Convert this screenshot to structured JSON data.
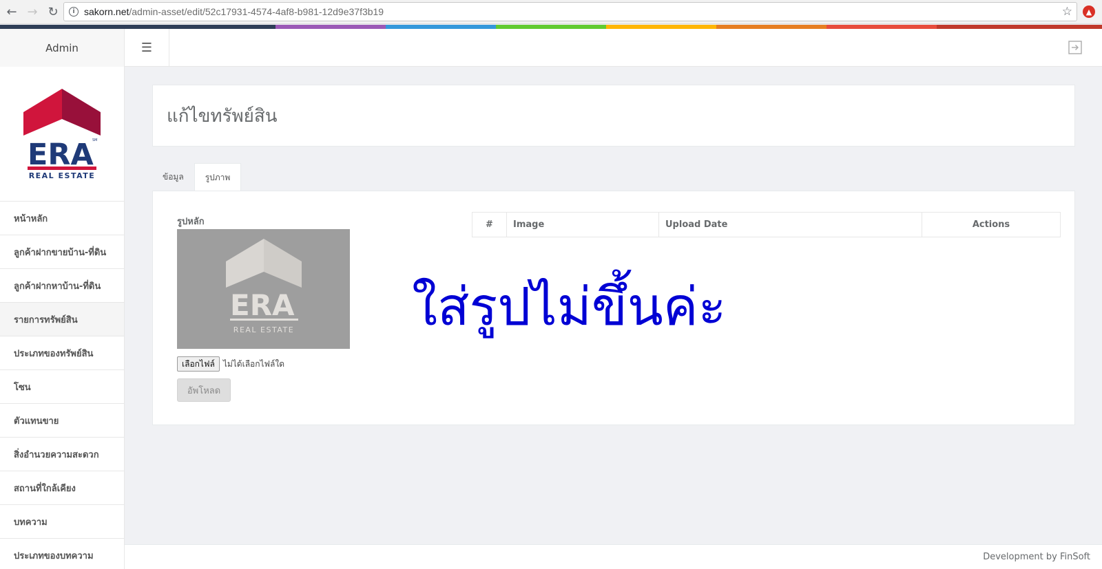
{
  "browser": {
    "url_host": "sakorn.net",
    "url_path": "/admin-asset/edit/52c17931-4574-4af8-b981-12d9e37f3b19"
  },
  "header": {
    "brand": "Admin",
    "menu_icon": "hamburger-icon",
    "logout_icon": "sign-out-icon"
  },
  "logo": {
    "brand": "ERA",
    "tagline": "REAL ESTATE",
    "sm_mark": "SM"
  },
  "sidebar": {
    "items": [
      {
        "label": "หน้าหลัก"
      },
      {
        "label": "ลูกค้าฝากขายบ้าน-ที่ดิน"
      },
      {
        "label": "ลูกค้าฝากหาบ้าน-ที่ดิน"
      },
      {
        "label": "รายการทรัพย์สิน"
      },
      {
        "label": "ประเภทของทรัพย์สิน"
      },
      {
        "label": "โซน"
      },
      {
        "label": "ตัวแทนขาย"
      },
      {
        "label": "สิ่งอำนวยความสะดวก"
      },
      {
        "label": "สถานที่ใกล้เคียง"
      },
      {
        "label": "บทความ"
      },
      {
        "label": "ประเภทของบทความ"
      }
    ]
  },
  "page": {
    "title": "แก้ไขทรัพย์สิน"
  },
  "tabs": [
    {
      "label": "ข้อมูล"
    },
    {
      "label": "รูปภาพ"
    }
  ],
  "images_panel": {
    "main_image_label": "รูปหลัก",
    "preview_brand": "ERA",
    "preview_tagline": "REAL ESTATE",
    "file_button": "เลือกไฟล์",
    "file_status": "ไม่ได้เลือกไฟล์ใด",
    "upload_button": "อัพโหลด",
    "table_headers": [
      "#",
      "Image",
      "Upload Date",
      "Actions"
    ]
  },
  "annotation": "ใส่รูปไม่ขึ้นค่ะ",
  "footer": {
    "text": "Development by FinSoft"
  },
  "colors": {
    "strip": [
      "#2f3e57",
      "#9b59b6",
      "#3498db",
      "#62cb31",
      "#ffb606",
      "#e67e22",
      "#e74c3c",
      "#c0392b"
    ],
    "annotation": "#0000d4",
    "era_red": "#d0153c",
    "era_navy": "#1f3a78"
  }
}
